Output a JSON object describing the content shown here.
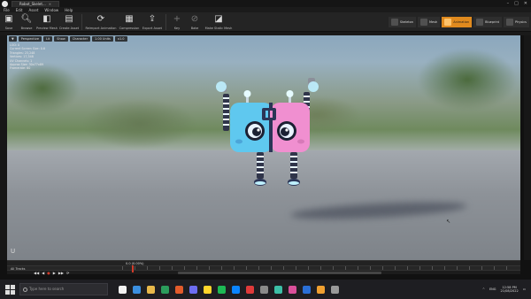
{
  "window": {
    "tab_title": "Robot_Skelet...",
    "controls": [
      "–",
      "□",
      "✕"
    ]
  },
  "menu": [
    "File",
    "Edit",
    "Asset",
    "Window",
    "Help"
  ],
  "toolbar": {
    "buttons": [
      {
        "label": "Save",
        "icon": "save-icon"
      },
      {
        "label": "Browse",
        "icon": "browse-icon"
      },
      {
        "label": "Preview Mesh",
        "icon": "preview-mesh-icon"
      },
      {
        "label": "Create Asset",
        "icon": "create-asset-icon"
      },
      {
        "label": "Reimport Animation",
        "icon": "reimport-icon"
      },
      {
        "label": "Compression",
        "icon": "compression-icon"
      },
      {
        "label": "Export Asset",
        "icon": "export-icon"
      },
      {
        "label": "Key",
        "icon": "key-icon"
      },
      {
        "label": "Bake",
        "icon": "bake-icon"
      },
      {
        "label": "Make Static Mesh",
        "icon": "static-mesh-icon"
      }
    ],
    "modes": [
      {
        "label": "Skeleton",
        "active": false
      },
      {
        "label": "Mesh",
        "active": false
      },
      {
        "label": "Animation",
        "active": true
      },
      {
        "label": "Blueprint",
        "active": false
      },
      {
        "label": "Physics",
        "active": false
      }
    ]
  },
  "viewport": {
    "buttons": [
      "Perspective",
      "Lit",
      "Show",
      "Character",
      "1.00 Units",
      "x1.0"
    ],
    "stats": [
      "LOD: 0",
      "Current Screen Size: 0.6",
      "Triangles: 23,248",
      "Vertices: 17,348",
      "UV Channels: 1",
      "Approx Size: 30x77x89",
      "Framerate: 60"
    ],
    "colors": {
      "accent": "#e08a1e",
      "robot_blue": "#5fc8ef",
      "robot_pink": "#f08fd0"
    }
  },
  "timeline": {
    "track_name": "All Tracks",
    "time_readout": "0.0 (0.00%)",
    "transport_icons": [
      "◀◀",
      "◀",
      "●",
      "▶",
      "▶▶",
      "⟳"
    ]
  },
  "taskbar": {
    "search_placeholder": "Type here to search",
    "app_colors": [
      "#f2f2f2",
      "#3b8fe0",
      "#e8b84a",
      "#2b9c5c",
      "#e25b2b",
      "#6d6df2",
      "#ffd52b",
      "#1db954",
      "#0a84ff",
      "#e03a3a",
      "#8a8a8a",
      "#3cbfa6",
      "#d94f9a",
      "#2a6fd6",
      "#f0a030",
      "#999999"
    ],
    "lang": "ENG",
    "time": "12:58 PM",
    "date": "21/08/2022"
  }
}
